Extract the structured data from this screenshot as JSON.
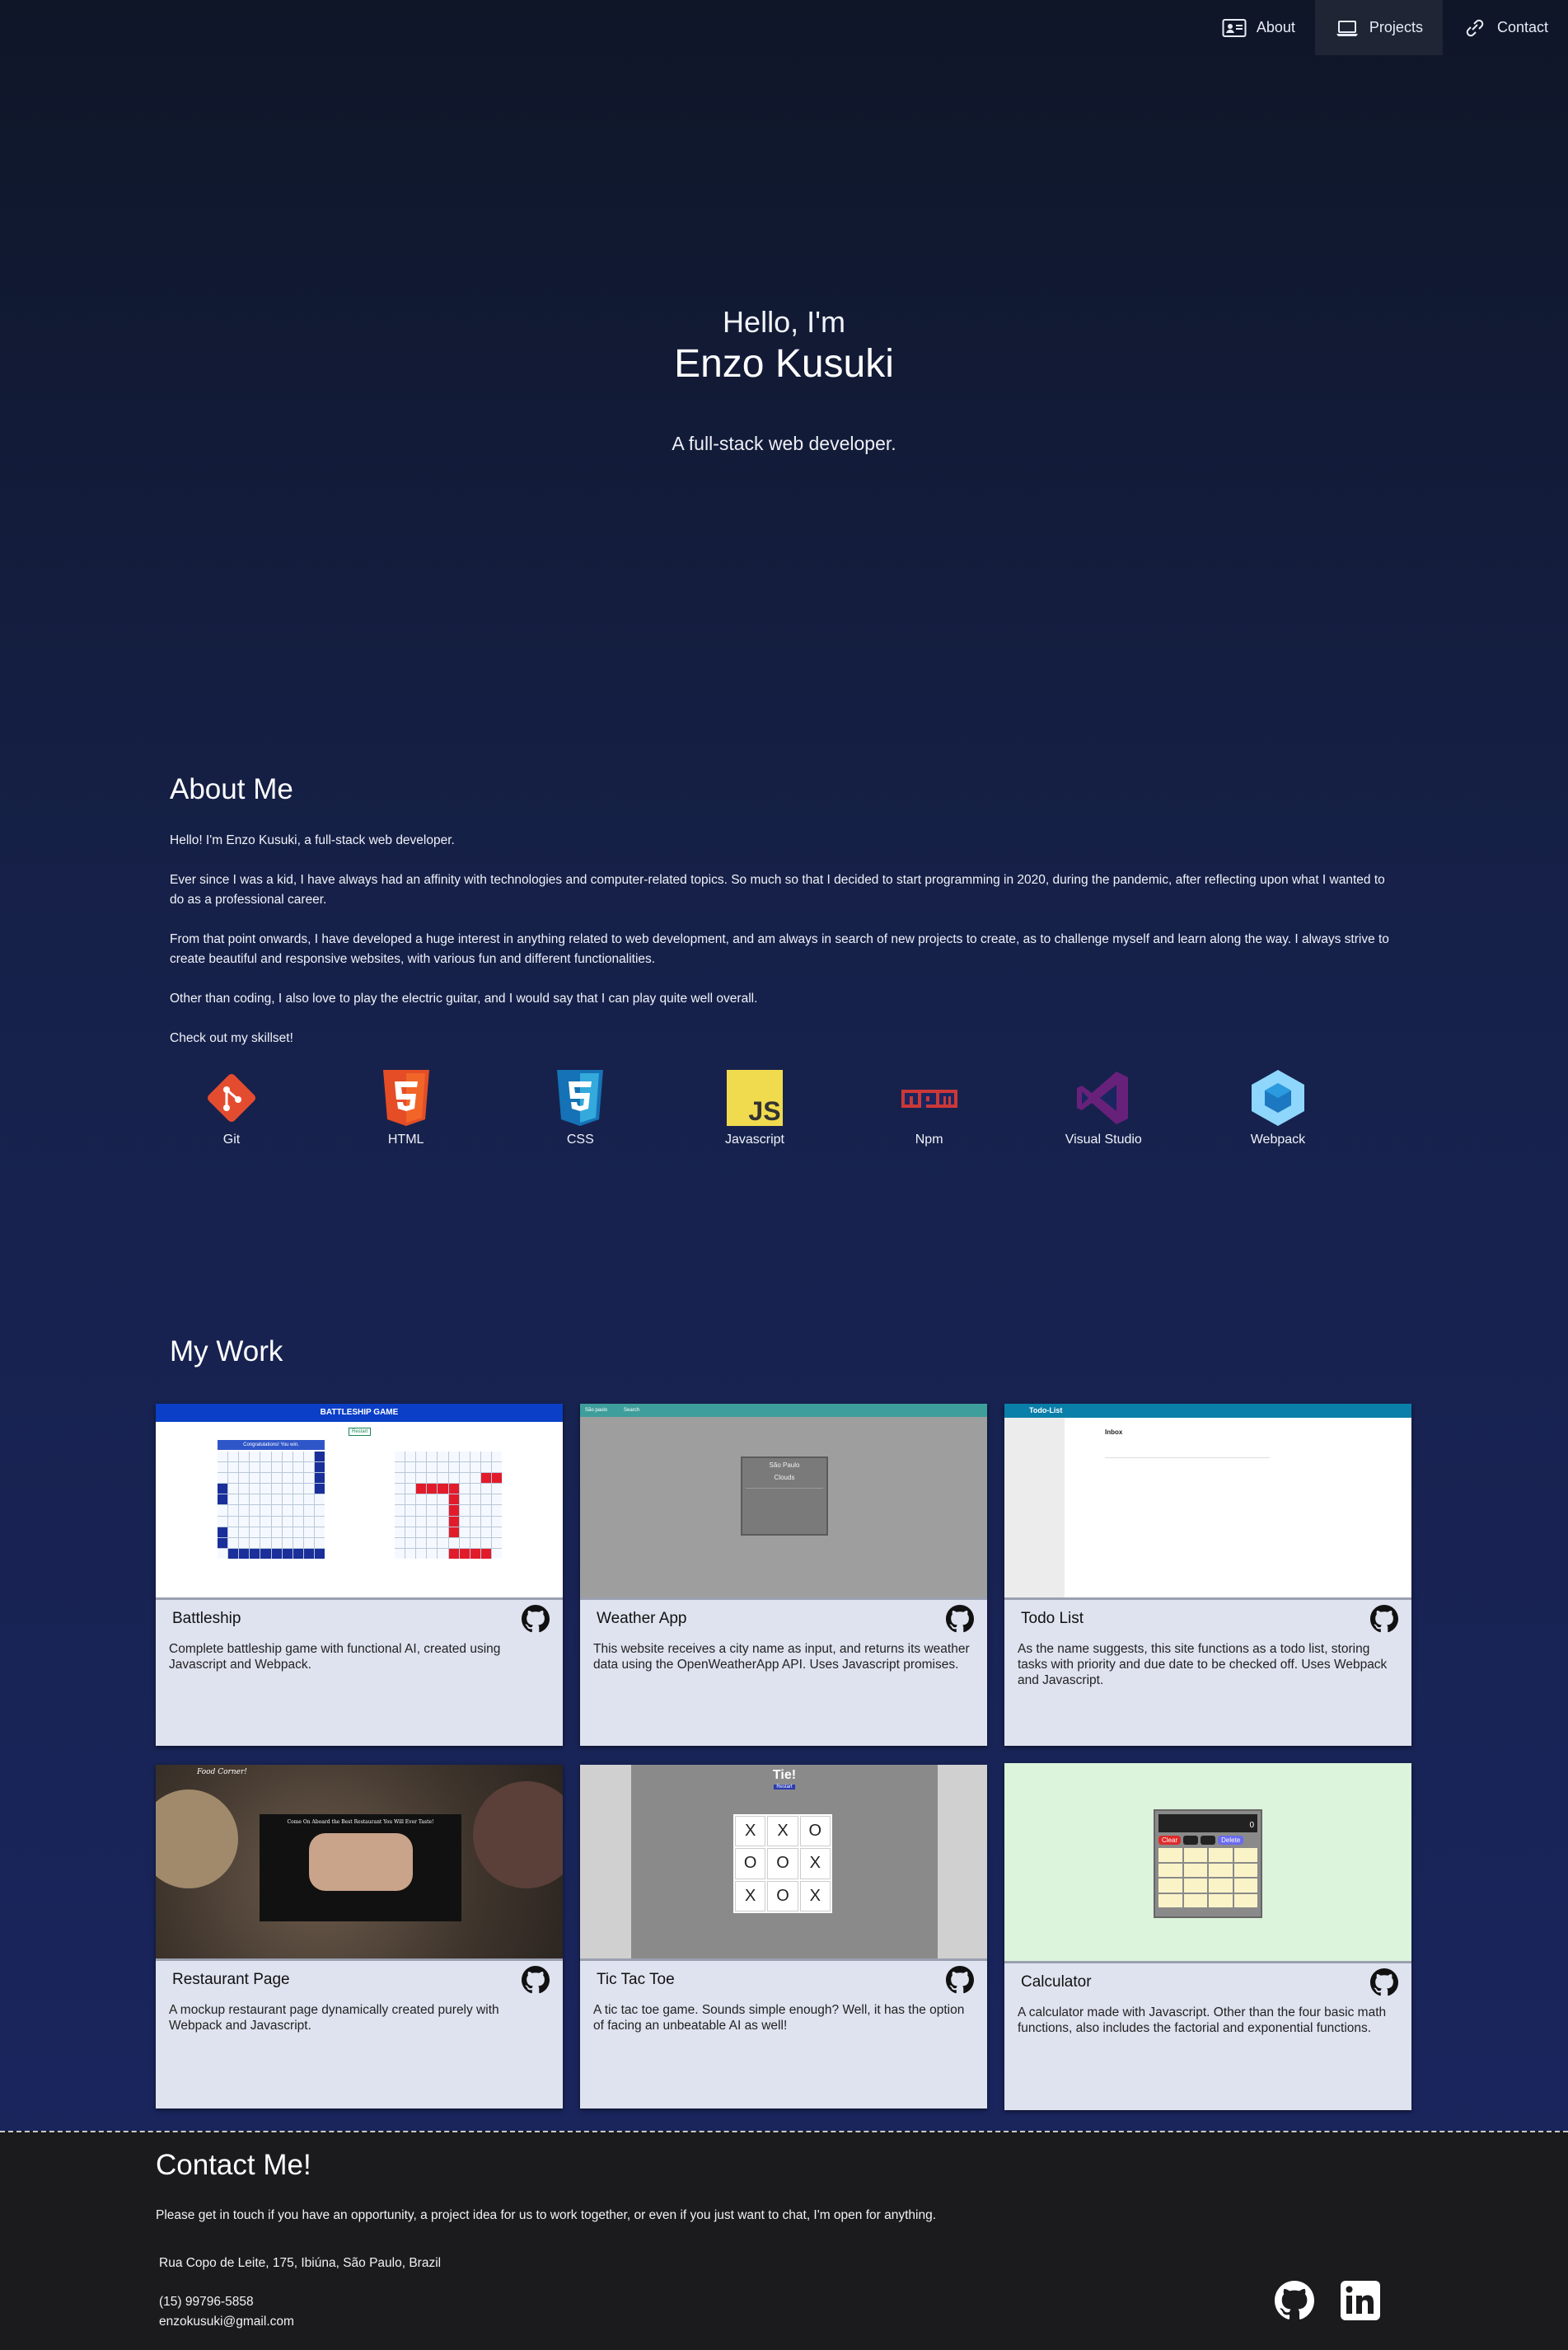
{
  "nav": {
    "items": [
      {
        "label": "About",
        "icon": "profile-card-icon",
        "active": false
      },
      {
        "label": "Projects",
        "icon": "laptop-icon",
        "active": true
      },
      {
        "label": "Contact",
        "icon": "link-icon",
        "active": false
      }
    ]
  },
  "hero": {
    "greeting": "Hello, I'm",
    "name": "Enzo Kusuki",
    "subtitle": "A full-stack web developer."
  },
  "about": {
    "title": "About Me",
    "paragraphs": [
      "Hello! I'm Enzo Kusuki, a full-stack web developer.",
      "Ever since I was a kid, I have always had an affinity with technologies and computer-related topics. So much so that I decided to start programming in 2020, during the pandemic, after reflecting upon what I wanted to do as a professional career.",
      "From that point onwards, I have developed a huge interest in anything related to web development, and am always in search of new projects to create, as to challenge myself and learn along the way. I always strive to create beautiful and responsive websites, with various fun and different functionalities.",
      "Other than coding, I also love to play the electric guitar, and I would say that I can play quite well overall.",
      "Check out my skillset!"
    ],
    "skills": [
      {
        "label": "Git",
        "icon": "git-icon",
        "color": "#e44c30"
      },
      {
        "label": "HTML",
        "icon": "html5-icon",
        "color": "#e44d26"
      },
      {
        "label": "CSS",
        "icon": "css3-icon",
        "color": "#1572b6"
      },
      {
        "label": "Javascript",
        "icon": "javascript-icon",
        "color": "#f0db4f"
      },
      {
        "label": "Npm",
        "icon": "npm-icon",
        "color": "#cb3837"
      },
      {
        "label": "Visual Studio",
        "icon": "visual-studio-icon",
        "color": "#68217a"
      },
      {
        "label": "Webpack",
        "icon": "webpack-icon",
        "color": "#8ed6fb"
      }
    ]
  },
  "work": {
    "title": "My Work",
    "projects": [
      {
        "title": "Battleship",
        "description": "Complete battleship game with functional AI, created using Javascript and Webpack.",
        "preview_header": "BATTLESHIP GAME",
        "preview_banner": "Congratulations! You win.",
        "preview_button": "Restart"
      },
      {
        "title": "Weather App",
        "description": "This website receives a city name as input, and returns its weather data using the OpenWeatherApp API. Uses Javascript promises.",
        "preview_city": "São Paulo",
        "preview_condition": "Clouds",
        "preview_search_left": "São paulo",
        "preview_search_right": "Search"
      },
      {
        "title": "Todo List",
        "description": "As the name suggests, this site functions as a todo list, storing tasks with priority and due date to be checked off. Uses Webpack and Javascript.",
        "preview_header": "Todo-List",
        "preview_inbox": "Inbox"
      },
      {
        "title": "Restaurant Page",
        "description": "A mockup restaurant page dynamically created purely with Webpack and Javascript.",
        "preview_brand": "Food Corner!",
        "preview_tagline": "Come On Aboard the Best Restaurant You Will Ever Taste!"
      },
      {
        "title": "Tic Tac Toe",
        "description": "A tic tac toe game. Sounds simple enough? Well, it has the option of facing an unbeatable AI as well!",
        "preview_result": "Tie!",
        "preview_button": "Restart",
        "board": [
          "X",
          "X",
          "O",
          "O",
          "O",
          "X",
          "X",
          "O",
          "X"
        ]
      },
      {
        "title": "Calculator",
        "description": "A calculator made with Javascript. Other than the four basic math functions, also includes the factorial and exponential functions.",
        "preview_display": "0",
        "preview_clear": "Clear",
        "preview_delete": "Delete"
      }
    ]
  },
  "contact": {
    "title": "Contact Me!",
    "text": "Please get in touch if you have an opportunity, a project idea for us to work together, or even if you just want to chat, I'm open for anything.",
    "address": "Rua Copo de Leite, 175, Ibiúna, São Paulo, Brazil",
    "phone": "(15) 99796-5858",
    "email": "enzokusuki@gmail.com"
  }
}
